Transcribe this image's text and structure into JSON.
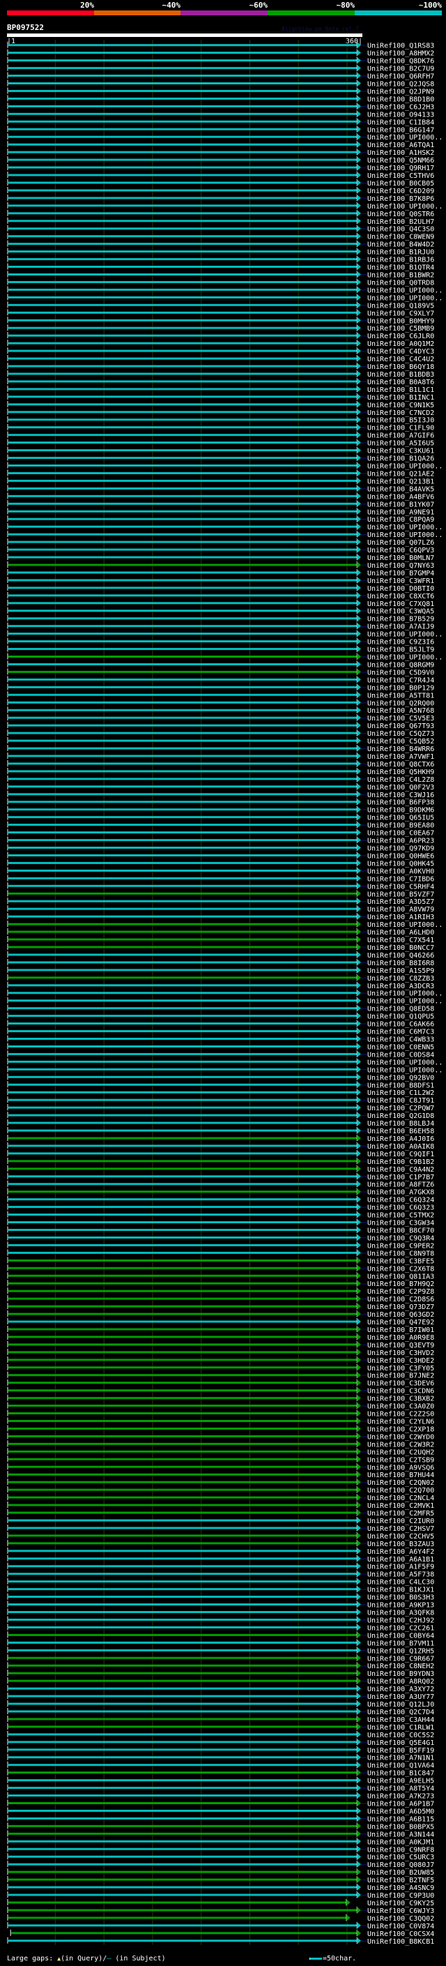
{
  "legend": {
    "bins": [
      {
        "label": "20%",
        "color": "#ff0022"
      },
      {
        "label": "~40%",
        "color": "#e06000"
      },
      {
        "label": "~60%",
        "color": "#a020a0"
      },
      {
        "label": "~80%",
        "color": "#00a000"
      },
      {
        "label": "~100%",
        "color": "#00c0c0"
      }
    ]
  },
  "header": {
    "title": "BP097522",
    "credit": "AlignView.pm Beta rel.7",
    "start": "|1",
    "end": "360|"
  },
  "query_length": 360,
  "rows": [
    [
      "UniRef100_Q1RS83",
      "~100%"
    ],
    [
      "UniRef100_A8HMX2",
      "~100%"
    ],
    [
      "UniRef100_Q8DK76",
      "~100%"
    ],
    [
      "UniRef100_B2C7U9",
      "~100%"
    ],
    [
      "UniRef100_Q6RFH7",
      "~100%"
    ],
    [
      "UniRef100_Q2JQS8",
      "~100%"
    ],
    [
      "UniRef100_Q2JPN9",
      "~100%"
    ],
    [
      "UniRef100_B8D1B0",
      "~100%"
    ],
    [
      "UniRef100_C6J2H3",
      "~100%"
    ],
    [
      "UniRef100_O94133",
      "~100%"
    ],
    [
      "UniRef100_C1IB84",
      "~100%"
    ],
    [
      "UniRef100_B6G147",
      "~100%"
    ],
    [
      "UniRef100_UPI000..",
      "~100%"
    ],
    [
      "UniRef100_A6TQA1",
      "~100%"
    ],
    [
      "UniRef100_A1HSK2",
      "~100%"
    ],
    [
      "UniRef100_Q5NM66",
      "~100%"
    ],
    [
      "UniRef100_Q9RH17",
      "~100%"
    ],
    [
      "UniRef100_C5THV6",
      "~100%"
    ],
    [
      "UniRef100_B0CB05",
      "~100%"
    ],
    [
      "UniRef100_C6D209",
      "~100%"
    ],
    [
      "UniRef100_B7K8P6",
      "~100%"
    ],
    [
      "UniRef100_UPI000..",
      "~100%"
    ],
    [
      "UniRef100_Q0STR6",
      "~100%"
    ],
    [
      "UniRef100_B2ULH7",
      "~100%"
    ],
    [
      "UniRef100_Q4C3S0",
      "~100%"
    ],
    [
      "UniRef100_C8WEN9",
      "~100%"
    ],
    [
      "UniRef100_B4W4D2",
      "~100%"
    ],
    [
      "UniRef100_B1RJU0",
      "~100%"
    ],
    [
      "UniRef100_B1RBJ6",
      "~100%"
    ],
    [
      "UniRef100_B1QTR4",
      "~100%"
    ],
    [
      "UniRef100_B1BWR2",
      "~100%"
    ],
    [
      "UniRef100_Q0TRD8",
      "~100%"
    ],
    [
      "UniRef100_UPI000..",
      "~100%"
    ],
    [
      "UniRef100_UPI000..",
      "~100%"
    ],
    [
      "UniRef100_Q189V5",
      "~100%"
    ],
    [
      "UniRef100_C9XLY7",
      "~100%"
    ],
    [
      "UniRef100_B0MHY9",
      "~100%"
    ],
    [
      "UniRef100_C5BMB9",
      "~100%"
    ],
    [
      "UniRef100_C6JLR0",
      "~100%"
    ],
    [
      "UniRef100_A0Q1M2",
      "~100%"
    ],
    [
      "UniRef100_C4DYC3",
      "~100%"
    ],
    [
      "UniRef100_C4C4U2",
      "~100%"
    ],
    [
      "UniRef100_B6QY18",
      "~100%"
    ],
    [
      "UniRef100_B1BDB3",
      "~100%"
    ],
    [
      "UniRef100_B0A8T6",
      "~100%"
    ],
    [
      "UniRef100_B1L1C1",
      "~100%"
    ],
    [
      "UniRef100_B1INC1",
      "~100%"
    ],
    [
      "UniRef100_C9N1K5",
      "~100%"
    ],
    [
      "UniRef100_C7NCD2",
      "~100%"
    ],
    [
      "UniRef100_B5I3J0",
      "~100%"
    ],
    [
      "UniRef100_C1FL90",
      "~100%"
    ],
    [
      "UniRef100_A7GIF6",
      "~100%"
    ],
    [
      "UniRef100_A5I6U5",
      "~100%"
    ],
    [
      "UniRef100_C3KU61",
      "~100%"
    ],
    [
      "UniRef100_B1QA26",
      "~100%"
    ],
    [
      "UniRef100_UPI000..",
      "~100%"
    ],
    [
      "UniRef100_Q21AE2",
      "~100%"
    ],
    [
      "UniRef100_Q213B1",
      "~100%"
    ],
    [
      "UniRef100_B4AVK5",
      "~100%"
    ],
    [
      "UniRef100_A4BFV6",
      "~100%"
    ],
    [
      "UniRef100_B1YK07",
      "~100%"
    ],
    [
      "UniRef100_A9NE91",
      "~100%"
    ],
    [
      "UniRef100_C8PQA9",
      "~100%"
    ],
    [
      "UniRef100_UPI000..",
      "~100%"
    ],
    [
      "UniRef100_UPI000..",
      "~100%"
    ],
    [
      "UniRef100_Q07LZ6",
      "~100%"
    ],
    [
      "UniRef100_C6QPV3",
      "~100%"
    ],
    [
      "UniRef100_B0MLN7",
      "~100%"
    ],
    [
      "UniRef100_Q7NY63",
      "~80%"
    ],
    [
      "UniRef100_B7GMP4",
      "~100%"
    ],
    [
      "UniRef100_C3WFR1",
      "~100%"
    ],
    [
      "UniRef100_D0BTI0",
      "~100%"
    ],
    [
      "UniRef100_C8XCT6",
      "~100%"
    ],
    [
      "UniRef100_C7XQ81",
      "~100%"
    ],
    [
      "UniRef100_C3WQA5",
      "~100%"
    ],
    [
      "UniRef100_B7B529",
      "~100%"
    ],
    [
      "UniRef100_A7AIJ9",
      "~100%"
    ],
    [
      "UniRef100_UPI000..",
      "~100%"
    ],
    [
      "UniRef100_C9Z3I6",
      "~100%"
    ],
    [
      "UniRef100_B5JLT9",
      "~100%"
    ],
    [
      "UniRef100_UPI000..",
      "~80%"
    ],
    [
      "UniRef100_Q8RGM9",
      "~100%"
    ],
    [
      "UniRef100_C5D9V0",
      "~80%"
    ],
    [
      "UniRef100_C7R4J4",
      "~100%"
    ],
    [
      "UniRef100_B0P129",
      "~100%"
    ],
    [
      "UniRef100_A5TT81",
      "~100%"
    ],
    [
      "UniRef100_Q2RQ00",
      "~100%"
    ],
    [
      "UniRef100_A5N768",
      "~100%"
    ],
    [
      "UniRef100_C5V5E3",
      "~100%"
    ],
    [
      "UniRef100_Q67T93",
      "~100%"
    ],
    [
      "UniRef100_C5QZ73",
      "~100%"
    ],
    [
      "UniRef100_C5QB52",
      "~100%"
    ],
    [
      "UniRef100_B4WRR6",
      "~100%"
    ],
    [
      "UniRef100_A7VWF1",
      "~100%"
    ],
    [
      "UniRef100_Q8CTX6",
      "~100%"
    ],
    [
      "UniRef100_Q5HKH9",
      "~100%"
    ],
    [
      "UniRef100_C4L2Z8",
      "~100%"
    ],
    [
      "UniRef100_Q0F2V3",
      "~100%"
    ],
    [
      "UniRef100_C3WJ16",
      "~100%"
    ],
    [
      "UniRef100_B6FP38",
      "~100%"
    ],
    [
      "UniRef100_B9DKM6",
      "~100%"
    ],
    [
      "UniRef100_Q65IU5",
      "~100%"
    ],
    [
      "UniRef100_B9EA80",
      "~100%"
    ],
    [
      "UniRef100_C0EA67",
      "~100%"
    ],
    [
      "UniRef100_A6PR23",
      "~100%"
    ],
    [
      "UniRef100_Q97KD9",
      "~100%"
    ],
    [
      "UniRef100_Q0HWE6",
      "~100%"
    ],
    [
      "UniRef100_Q0HK45",
      "~100%"
    ],
    [
      "UniRef100_A0KVH0",
      "~100%"
    ],
    [
      "UniRef100_C7IBD6",
      "~100%"
    ],
    [
      "UniRef100_C5RHF4",
      "~100%"
    ],
    [
      "UniRef100_B5VZF7",
      "~80%"
    ],
    [
      "UniRef100_A3D5Z7",
      "~100%"
    ],
    [
      "UniRef100_A8VW79",
      "~100%"
    ],
    [
      "UniRef100_A1RIH3",
      "~100%"
    ],
    [
      "UniRef100_UPI000..",
      "~80%"
    ],
    [
      "UniRef100_A6LHD0",
      "~80%"
    ],
    [
      "UniRef100_C7X541",
      "~80%"
    ],
    [
      "UniRef100_B0NCC7",
      "~80%"
    ],
    [
      "UniRef100_Q46266",
      "~100%"
    ],
    [
      "UniRef100_B8I6R8",
      "~100%"
    ],
    [
      "UniRef100_A1S5P9",
      "~100%"
    ],
    [
      "UniRef100_C8ZZB3",
      "~80%"
    ],
    [
      "UniRef100_A3DCR3",
      "~100%"
    ],
    [
      "UniRef100_UPI000..",
      "~100%"
    ],
    [
      "UniRef100_UPI000..",
      "~100%"
    ],
    [
      "UniRef100_Q8ED58",
      "~100%"
    ],
    [
      "UniRef100_Q1QPU5",
      "~100%"
    ],
    [
      "UniRef100_C6AK66",
      "~100%"
    ],
    [
      "UniRef100_C6M7C3",
      "~100%"
    ],
    [
      "UniRef100_C4WB33",
      "~100%"
    ],
    [
      "UniRef100_C0ENN5",
      "~100%"
    ],
    [
      "UniRef100_C0DS84",
      "~100%"
    ],
    [
      "UniRef100_UPI000..",
      "~100%"
    ],
    [
      "UniRef100_UPI000..",
      "~100%"
    ],
    [
      "UniRef100_Q92BV0",
      "~100%"
    ],
    [
      "UniRef100_B8DFS1",
      "~100%"
    ],
    [
      "UniRef100_C1L2W2",
      "~100%"
    ],
    [
      "UniRef100_C8JT91",
      "~100%"
    ],
    [
      "UniRef100_C2PQW7",
      "~100%"
    ],
    [
      "UniRef100_Q2G1D8",
      "~100%"
    ],
    [
      "UniRef100_B8LBJ4",
      "~100%"
    ],
    [
      "UniRef100_B6EH58",
      "~100%"
    ],
    [
      "UniRef100_A4J0I6",
      "~80%"
    ],
    [
      "UniRef100_A0AIK8",
      "~100%"
    ],
    [
      "UniRef100_C9QIF1",
      "~100%"
    ],
    [
      "UniRef100_C9B1B2",
      "~80%"
    ],
    [
      "UniRef100_C9A4N2",
      "~80%"
    ],
    [
      "UniRef100_C1P7B7",
      "~100%"
    ],
    [
      "UniRef100_A8FTZ6",
      "~100%"
    ],
    [
      "UniRef100_A7GKX8",
      "~80%"
    ],
    [
      "UniRef100_C6Q324",
      "~100%"
    ],
    [
      "UniRef100_C6Q323",
      "~100%"
    ],
    [
      "UniRef100_C5TMX2",
      "~100%"
    ],
    [
      "UniRef100_C3GW34",
      "~100%"
    ],
    [
      "UniRef100_B8CF70",
      "~100%"
    ],
    [
      "UniRef100_C9Q3R4",
      "~100%"
    ],
    [
      "UniRef100_C9PER2",
      "~100%"
    ],
    [
      "UniRef100_C8N9T8",
      "~100%"
    ],
    [
      "UniRef100_C3BFE5",
      "~80%"
    ],
    [
      "UniRef100_C2X6T8",
      "~80%"
    ],
    [
      "UniRef100_Q81IA3",
      "~80%"
    ],
    [
      "UniRef100_B7H9Q2",
      "~80%"
    ],
    [
      "UniRef100_C2P9Z8",
      "~80%"
    ],
    [
      "UniRef100_C2D8S6",
      "~80%"
    ],
    [
      "UniRef100_Q73DZ7",
      "~80%"
    ],
    [
      "UniRef100_Q63GD2",
      "~80%"
    ],
    [
      "UniRef100_Q47E92",
      "~100%"
    ],
    [
      "UniRef100_B7IW01",
      "~80%"
    ],
    [
      "UniRef100_A0R9E8",
      "~80%"
    ],
    [
      "UniRef100_Q3EVT9",
      "~80%"
    ],
    [
      "UniRef100_C3HVD2",
      "~80%"
    ],
    [
      "UniRef100_C3HDE2",
      "~80%"
    ],
    [
      "UniRef100_C3FY05",
      "~80%"
    ],
    [
      "UniRef100_B7JNE2",
      "~80%"
    ],
    [
      "UniRef100_C3DEV6",
      "~80%"
    ],
    [
      "UniRef100_C3CDN6",
      "~80%"
    ],
    [
      "UniRef100_C3BXB2",
      "~80%"
    ],
    [
      "UniRef100_C3A0Z0",
      "~80%"
    ],
    [
      "UniRef100_C2Z2S0",
      "~80%"
    ],
    [
      "UniRef100_C2YLN6",
      "~80%"
    ],
    [
      "UniRef100_C2XP18",
      "~80%"
    ],
    [
      "UniRef100_C2WYD0",
      "~80%"
    ],
    [
      "UniRef100_C2W3R2",
      "~80%"
    ],
    [
      "UniRef100_C2UQH2",
      "~80%"
    ],
    [
      "UniRef100_C2TSB9",
      "~80%"
    ],
    [
      "UniRef100_A9VSQ6",
      "~80%"
    ],
    [
      "UniRef100_B7HU44",
      "~80%"
    ],
    [
      "UniRef100_C2QN02",
      "~80%"
    ],
    [
      "UniRef100_C2Q700",
      "~80%"
    ],
    [
      "UniRef100_C2NCL4",
      "~80%"
    ],
    [
      "UniRef100_C2MVK1",
      "~80%"
    ],
    [
      "UniRef100_C2MFR5",
      "~80%"
    ],
    [
      "UniRef100_C2IUR0",
      "~100%"
    ],
    [
      "UniRef100_C2HSV7",
      "~100%"
    ],
    [
      "UniRef100_C2CHV5",
      "~80%"
    ],
    [
      "UniRef100_B3ZAU3",
      "~80%"
    ],
    [
      "UniRef100_A6Y4F2",
      "~100%"
    ],
    [
      "UniRef100_A6A1B1",
      "~100%"
    ],
    [
      "UniRef100_A1F5F9",
      "~100%"
    ],
    [
      "UniRef100_A5F738",
      "~100%"
    ],
    [
      "UniRef100_C4LC30",
      "~100%"
    ],
    [
      "UniRef100_B1KJX1",
      "~100%"
    ],
    [
      "UniRef100_B0S3H3",
      "~100%"
    ],
    [
      "UniRef100_A9KP13",
      "~100%"
    ],
    [
      "UniRef100_A3QFK8",
      "~100%"
    ],
    [
      "UniRef100_C2HJ92",
      "~100%"
    ],
    [
      "UniRef100_C2C261",
      "~100%"
    ],
    [
      "UniRef100_C0BY64",
      "~80%"
    ],
    [
      "UniRef100_B7VM11",
      "~100%"
    ],
    [
      "UniRef100_Q1ZRH5",
      "~100%"
    ],
    [
      "UniRef100_C9R667",
      "~80%"
    ],
    [
      "UniRef100_C8NEH2",
      "~80%"
    ],
    [
      "UniRef100_B9YDN3",
      "~80%"
    ],
    [
      "UniRef100_A8RQ02",
      "~80%"
    ],
    [
      "UniRef100_A3XY72",
      "~100%"
    ],
    [
      "UniRef100_A3UY77",
      "~100%"
    ],
    [
      "UniRef100_Q12LJ0",
      "~100%"
    ],
    [
      "UniRef100_Q2C7D4",
      "~100%"
    ],
    [
      "UniRef100_C3AH44",
      "~80%"
    ],
    [
      "UniRef100_C1RLW1",
      "~80%"
    ],
    [
      "UniRef100_C0C5S2",
      "~100%"
    ],
    [
      "UniRef100_Q5E4G1",
      "~100%"
    ],
    [
      "UniRef100_B5FF19",
      "~100%"
    ],
    [
      "UniRef100_A7N1N1",
      "~100%"
    ],
    [
      "UniRef100_Q1VA64",
      "~100%"
    ],
    [
      "UniRef100_B1C847",
      "~80%"
    ],
    [
      "UniRef100_A9ELH5",
      "~100%"
    ],
    [
      "UniRef100_A8T5Y4",
      "~100%"
    ],
    [
      "UniRef100_A7K273",
      "~100%"
    ],
    [
      "UniRef100_A6P1B7",
      "~80%"
    ],
    [
      "UniRef100_A6D5M0",
      "~100%"
    ],
    [
      "UniRef100_A6B115",
      "~100%"
    ],
    [
      "UniRef100_B0BPX5",
      "~80%"
    ],
    [
      "UniRef100_A3N144",
      "~80%"
    ],
    [
      "UniRef100_A0KJM1",
      "~100%"
    ],
    [
      "UniRef100_C9NRF8",
      "~100%"
    ],
    [
      "UniRef100_C5URC3",
      "~100%"
    ],
    [
      "UniRef100_Q080J7",
      "~100%"
    ],
    [
      "UniRef100_B2UW85",
      "~80%"
    ],
    [
      "UniRef100_B2TNF5",
      "~80%"
    ],
    [
      "UniRef100_A4SNC9",
      "~100%"
    ],
    [
      "UniRef100_C9P3U0",
      "~100%"
    ],
    [
      "UniRef100_C9KY25",
      "~80%",
      1,
      349
    ],
    [
      "UniRef100_C6WJY3",
      "~80%"
    ],
    [
      "UniRef100_C3QQ02",
      "~80%",
      1,
      349
    ],
    [
      "UniRef100_C0V874",
      "~100%"
    ],
    [
      "UniRef100_C0CSX4",
      "~80%",
      4,
      360
    ],
    [
      "UniRef100_B8KCB1",
      "~100%"
    ]
  ],
  "footer": {
    "gaps_label": "Large gaps: ",
    "query_marker": "▲",
    "query_text": "(in Query)/",
    "subject_marker": "—",
    "subject_text": " (in Subject)",
    "scale_text": "=50char."
  }
}
